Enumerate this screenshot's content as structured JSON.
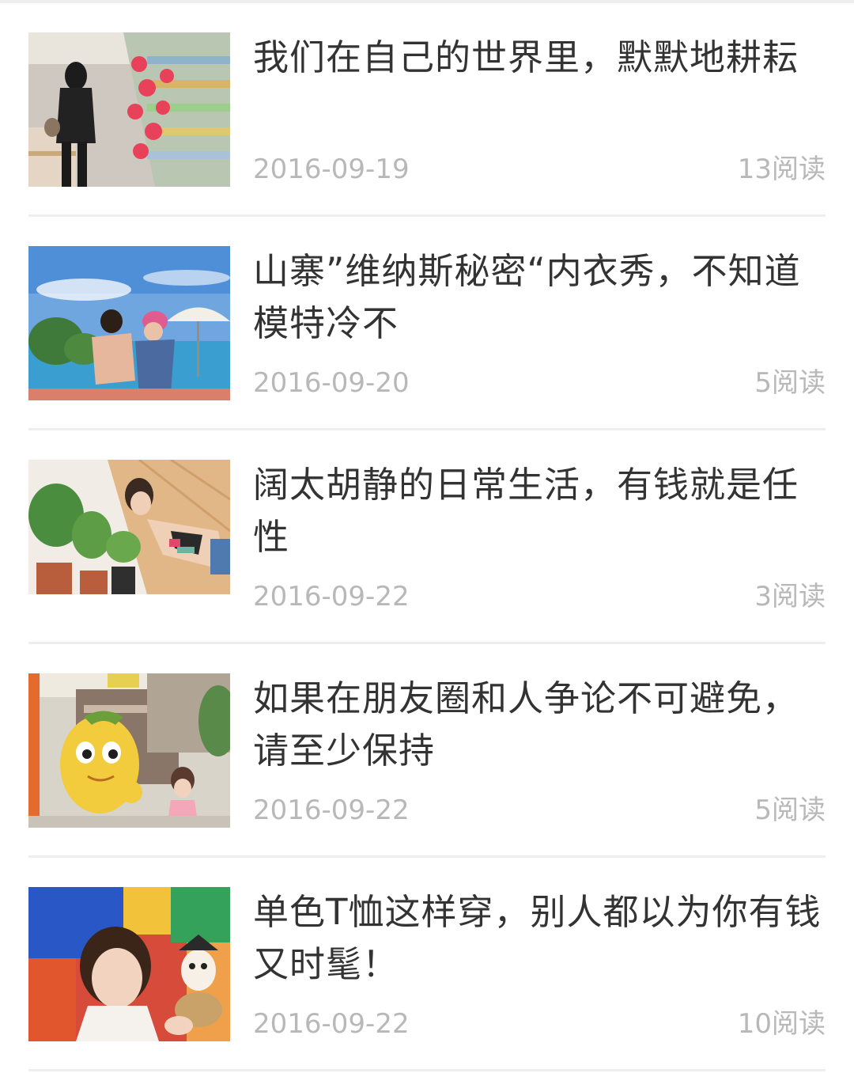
{
  "articles": [
    {
      "title": "我们在自己的世界里，默默地耕耘",
      "date": "2016-09-19",
      "reads": "13阅读",
      "thumbnail": "supermarket-aisle-photo"
    },
    {
      "title": "山寨”维纳斯秘密“内衣秀，不知道模特冷不",
      "date": "2016-09-20",
      "reads": "5阅读",
      "thumbnail": "beach-couple-photo"
    },
    {
      "title": "阔太胡静的日常生活，有钱就是任性",
      "date": "2016-09-22",
      "reads": "3阅读",
      "thumbnail": "woman-with-plants-photo"
    },
    {
      "title": "如果在朋友圈和人争论不可避免，请至少保持",
      "date": "2016-09-22",
      "reads": "5阅读",
      "thumbnail": "mango-mascot-street-photo"
    },
    {
      "title": "单色T恤这样穿，别人都以为你有钱又时髦！",
      "date": "2016-09-22",
      "reads": "10阅读",
      "thumbnail": "woman-colorful-playground-photo"
    }
  ]
}
